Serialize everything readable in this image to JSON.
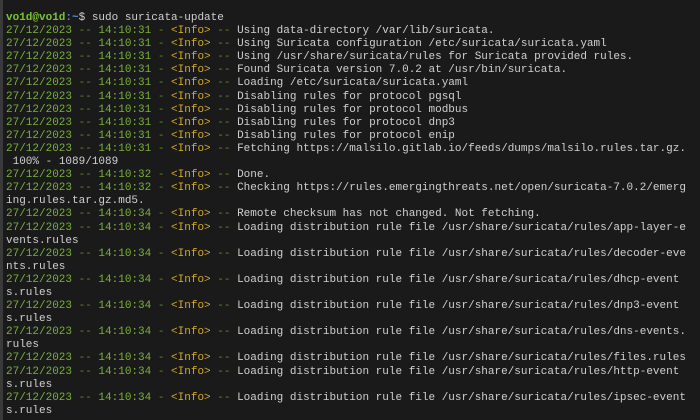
{
  "prompt": {
    "user_host": "vo1d@vo1d",
    "path": ":~",
    "symbol": "$ ",
    "command": "sudo suricata-update"
  },
  "colors": {
    "background": "#1a1a1a",
    "date": "#77b23a",
    "level": "#d4a72c",
    "text": "#d0d0d0",
    "prompt_user": "#7cc236",
    "prompt_path": "#5a8fd6"
  },
  "lines": [
    {
      "date": "27/12/2023",
      "time": "14:10:31",
      "level": "<Info>",
      "msg": "Using data-directory /var/lib/suricata."
    },
    {
      "date": "27/12/2023",
      "time": "14:10:31",
      "level": "<Info>",
      "msg": "Using Suricata configuration /etc/suricata/suricata.yaml"
    },
    {
      "date": "27/12/2023",
      "time": "14:10:31",
      "level": "<Info>",
      "msg": "Using /usr/share/suricata/rules for Suricata provided rules."
    },
    {
      "date": "27/12/2023",
      "time": "14:10:31",
      "level": "<Info>",
      "msg": "Found Suricata version 7.0.2 at /usr/bin/suricata."
    },
    {
      "date": "27/12/2023",
      "time": "14:10:31",
      "level": "<Info>",
      "msg": "Loading /etc/suricata/suricata.yaml"
    },
    {
      "date": "27/12/2023",
      "time": "14:10:31",
      "level": "<Info>",
      "msg": "Disabling rules for protocol pgsql"
    },
    {
      "date": "27/12/2023",
      "time": "14:10:31",
      "level": "<Info>",
      "msg": "Disabling rules for protocol modbus"
    },
    {
      "date": "27/12/2023",
      "time": "14:10:31",
      "level": "<Info>",
      "msg": "Disabling rules for protocol dnp3"
    },
    {
      "date": "27/12/2023",
      "time": "14:10:31",
      "level": "<Info>",
      "msg": "Disabling rules for protocol enip"
    },
    {
      "date": "27/12/2023",
      "time": "14:10:31",
      "level": "<Info>",
      "msg": "Fetching https://malsilo.gitlab.io/feeds/dumps/malsilo.rules.tar.gz."
    },
    {
      "plain": " 100% - 1089/1089"
    },
    {
      "date": "27/12/2023",
      "time": "14:10:32",
      "level": "<Info>",
      "msg": "Done."
    },
    {
      "date": "27/12/2023",
      "time": "14:10:32",
      "level": "<Info>",
      "msg": "Checking https://rules.emergingthreats.net/open/suricata-7.0.2/emerging.rules.tar.gz.md5."
    },
    {
      "date": "27/12/2023",
      "time": "14:10:34",
      "level": "<Info>",
      "msg": "Remote checksum has not changed. Not fetching."
    },
    {
      "date": "27/12/2023",
      "time": "14:10:34",
      "level": "<Info>",
      "msg": "Loading distribution rule file /usr/share/suricata/rules/app-layer-events.rules"
    },
    {
      "date": "27/12/2023",
      "time": "14:10:34",
      "level": "<Info>",
      "msg": "Loading distribution rule file /usr/share/suricata/rules/decoder-events.rules"
    },
    {
      "date": "27/12/2023",
      "time": "14:10:34",
      "level": "<Info>",
      "msg": "Loading distribution rule file /usr/share/suricata/rules/dhcp-events.rules"
    },
    {
      "date": "27/12/2023",
      "time": "14:10:34",
      "level": "<Info>",
      "msg": "Loading distribution rule file /usr/share/suricata/rules/dnp3-events.rules"
    },
    {
      "date": "27/12/2023",
      "time": "14:10:34",
      "level": "<Info>",
      "msg": "Loading distribution rule file /usr/share/suricata/rules/dns-events.rules"
    },
    {
      "date": "27/12/2023",
      "time": "14:10:34",
      "level": "<Info>",
      "msg": "Loading distribution rule file /usr/share/suricata/rules/files.rules"
    },
    {
      "date": "27/12/2023",
      "time": "14:10:34",
      "level": "<Info>",
      "msg": "Loading distribution rule file /usr/share/suricata/rules/http-events.rules"
    },
    {
      "date": "27/12/2023",
      "time": "14:10:34",
      "level": "<Info>",
      "msg": "Loading distribution rule file /usr/share/suricata/rules/ipsec-events.rules"
    }
  ]
}
